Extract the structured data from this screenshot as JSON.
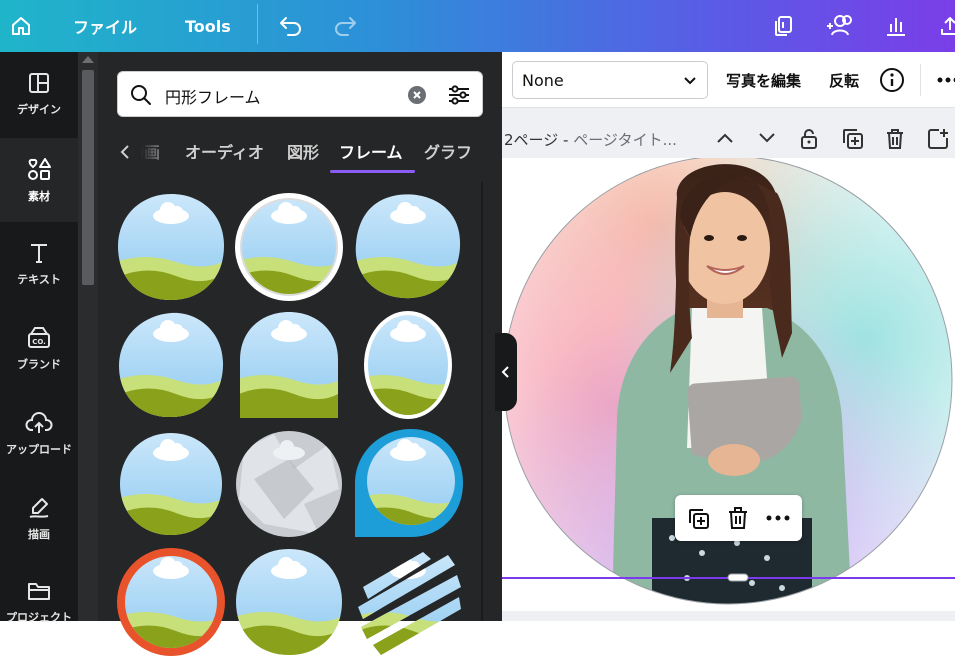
{
  "topbar": {
    "file_label": "ファイル",
    "tools_label": "Tools"
  },
  "rail": {
    "items": [
      {
        "label": "デザイン",
        "icon": "layout-icon"
      },
      {
        "label": "素材",
        "icon": "elements-icon"
      },
      {
        "label": "テキスト",
        "icon": "text-icon"
      },
      {
        "label": "ブランド",
        "icon": "brand-icon"
      },
      {
        "label": "アップロード",
        "icon": "upload-cloud-icon"
      },
      {
        "label": "描画",
        "icon": "draw-icon"
      },
      {
        "label": "プロジェクト",
        "icon": "folder-icon"
      }
    ],
    "brand_badge": "CO."
  },
  "panel": {
    "search_value": "円形フレーム",
    "tabs": [
      "動画",
      "オーディオ",
      "図形",
      "フレーム",
      "グラフ"
    ],
    "active_tab": "フレーム"
  },
  "context_toolbar": {
    "font_value": "None",
    "edit_photo_label": "写真を編集",
    "flip_label": "反転"
  },
  "page_header": {
    "page_number": "2ページ - ",
    "page_title": "ページタイト..."
  },
  "colors": {
    "accent": "#8b5cf6",
    "selection": "#7c3aed",
    "frame_orange": "#e8532b",
    "frame_blue": "#1e9ed8"
  }
}
